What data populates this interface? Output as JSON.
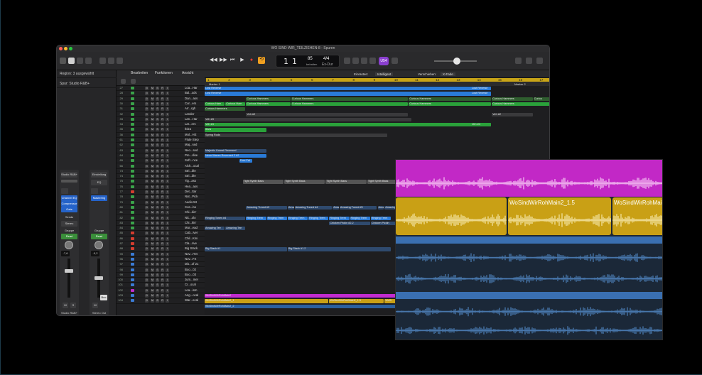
{
  "window": {
    "title": "WO SIND WIR_TEILZIEHEN-8 - Spuren"
  },
  "lcd": {
    "bar": "1",
    "beat": "1",
    "tempo": "85",
    "tempo_label": "behalten",
    "signature": "4/4",
    "key": "Es-Dur"
  },
  "mode_button": "U54",
  "inspector": {
    "region_label": "Region: 3 ausgewählt",
    "track_label": "Spur: Studio R&B+",
    "strip1": {
      "name": "Studio R&B+",
      "settings": "Studio R&B+",
      "eq": "Channel EQ",
      "comp": "Compressor",
      "gate": "Gate",
      "sends": "Sends",
      "stereo": "Stereo",
      "group": "Gruppe",
      "read": "Read",
      "value": "-7,6",
      "m": "M",
      "s": "S"
    },
    "strip2": {
      "name": "Stereo Out",
      "settings": "Einstellung",
      "eq": "EQ",
      "mastering": "Mastering",
      "group": "Gruppe",
      "read": "Read",
      "value": "-0,2",
      "m": "M",
      "bnc": "Bnc"
    }
  },
  "track_header": {
    "menus": [
      "Bearbeiten",
      "Funktionen",
      "Ansicht"
    ]
  },
  "tracks": [
    {
      "num": "27",
      "name": "Loa...Har",
      "color": "#3aa34a"
    },
    {
      "num": "28",
      "name": "Bal...ods",
      "color": "#3aa34a"
    },
    {
      "num": "29",
      "name": "Dan...ass",
      "color": "#3aa34a"
    },
    {
      "num": "30",
      "name": "Cur...ers",
      "color": "#3aa34a"
    },
    {
      "num": "31",
      "name": "Arr...rgh",
      "color": "#3aa34a"
    },
    {
      "num": "32",
      "name": "Lander",
      "color": "#3aa34a"
    },
    {
      "num": "33",
      "name": "Lan...Har",
      "color": "#3aa34a"
    },
    {
      "num": "34",
      "name": "Lar...ers",
      "color": "#3aa34a"
    },
    {
      "num": "35",
      "name": "Ibiza",
      "color": "#3aa34a"
    },
    {
      "num": "36",
      "name": "Mol...HE",
      "color": "#3aa34a"
    },
    {
      "num": "61",
      "name": "Flute Step",
      "color": "#3aa34a"
    },
    {
      "num": "62",
      "name": "Maj...sed",
      "color": "#3aa34a"
    },
    {
      "num": "63",
      "name": "Neo...sed",
      "color": "#3aa34a"
    },
    {
      "num": "64",
      "name": "Pre...dise",
      "color": "#3aa34a"
    },
    {
      "num": "65",
      "name": "Soft...nce",
      "color": "#3aa34a"
    },
    {
      "num": "66",
      "name": "Alch...ocal",
      "color": "#3aa34a"
    },
    {
      "num": "73",
      "name": "Stri...ble",
      "color": "#3aa34a"
    },
    {
      "num": "74",
      "name": "Stri...ble",
      "color": "#3aa34a"
    },
    {
      "num": "75",
      "name": "Tig...ass",
      "color": "#3aa34a"
    },
    {
      "num": "76",
      "name": "Hea...ass",
      "color": "#3aa34a"
    },
    {
      "num": "77",
      "name": "Det...ttar",
      "color": "#d43d2f"
    },
    {
      "num": "78",
      "name": "Nat...Pick",
      "color": "#3aa34a"
    },
    {
      "num": "79",
      "name": "Audio 53",
      "color": "#3aa34a"
    },
    {
      "num": "80",
      "name": "Cos...bo",
      "color": "#3aa34a"
    },
    {
      "num": "81",
      "name": "Chi...kin'",
      "color": "#3aa34a"
    },
    {
      "num": "82",
      "name": "Nic...olo",
      "color": "#3aa34a"
    },
    {
      "num": "83",
      "name": "Chi...kin'",
      "color": "#3aa34a"
    },
    {
      "num": "84",
      "name": "Mur...ead",
      "color": "#3aa34a"
    },
    {
      "num": "85",
      "name": "Cab...iver",
      "color": "#d43d2f"
    },
    {
      "num": "86",
      "name": "Chil...Kini",
      "color": "#d43d2f"
    },
    {
      "num": "87",
      "name": "Cla...rive",
      "color": "#d43d2f"
    },
    {
      "num": "88",
      "name": "Big Stack",
      "color": "#d43d2f"
    },
    {
      "num": "99",
      "name": "Nov...r'94",
      "color": "#3a7bd5"
    },
    {
      "num": "96",
      "name": "Nov...FX",
      "color": "#3a7bd5"
    },
    {
      "num": "97",
      "name": "Dis...of 21",
      "color": "#3a7bd5"
    },
    {
      "num": "98",
      "name": "Boo...02",
      "color": "#3a7bd5"
    },
    {
      "num": "99",
      "name": "Boo...03",
      "color": "#3a7bd5"
    },
    {
      "num": "100",
      "name": "Jum...mer",
      "color": "#3a7bd5"
    },
    {
      "num": "101",
      "name": "Cr...ocal",
      "color": "#3a7bd5"
    },
    {
      "num": "102",
      "name": "Lea...ism",
      "color": "#c22bd0"
    },
    {
      "num": "103",
      "name": "Ang...ocal",
      "color": "#3a7bd5"
    },
    {
      "num": "104",
      "name": "War...ocal",
      "color": "#3a7bd5"
    }
  ],
  "arrange": {
    "toolbar": {
      "snap_label": "Einrasten:",
      "snap_value": "Intelligent",
      "drag_label": "Verschieben:",
      "drag_value": "X-Fade"
    },
    "bars": [
      "1",
      "2",
      "3",
      "4",
      "5",
      "6",
      "7",
      "8",
      "9",
      "10",
      "11",
      "12",
      "13",
      "14",
      "15",
      "16",
      "17"
    ],
    "markers": [
      "Marker 1",
      "Marker 2"
    ],
    "regions": [
      {
        "lane": 0,
        "start": 0.0,
        "end": 0.83,
        "color": "#2a7bd8",
        "label": "Lost Reverse"
      },
      {
        "lane": 0,
        "start": 0.77,
        "end": 0.83,
        "color": "#2a7bd8",
        "label": "Lost Reverse"
      },
      {
        "lane": 1,
        "start": 0.0,
        "end": 0.83,
        "color": "#2a7bd8",
        "label": "Lost Reverse"
      },
      {
        "lane": 1,
        "start": 0.77,
        "end": 0.83,
        "color": "#2a7bd8",
        "label": "Lost Reverse"
      },
      {
        "lane": 2,
        "start": 0.12,
        "end": 0.25,
        "color": "#2f5e2f",
        "label": "Curious Hammers"
      },
      {
        "lane": 2,
        "start": 0.25,
        "end": 0.59,
        "color": "#2f5e2f",
        "label": "Curious Hammers"
      },
      {
        "lane": 2,
        "start": 0.59,
        "end": 0.83,
        "color": "#2f5e2f",
        "label": "Curious Hammers"
      },
      {
        "lane": 2,
        "start": 0.83,
        "end": 0.95,
        "color": "#2f5e2f",
        "label": "Curious Hammers"
      },
      {
        "lane": 2,
        "start": 0.95,
        "end": 1.0,
        "color": "#2f5e2f",
        "label": "Curiou"
      },
      {
        "lane": 3,
        "start": 0.0,
        "end": 0.06,
        "color": "#2aa13a",
        "label": "Curious Ham"
      },
      {
        "lane": 3,
        "start": 0.06,
        "end": 0.12,
        "color": "#2aa13a",
        "label": "Curious Ham"
      },
      {
        "lane": 3,
        "start": 0.12,
        "end": 0.25,
        "color": "#2aa13a",
        "label": "Curious Hammers"
      },
      {
        "lane": 3,
        "start": 0.25,
        "end": 0.59,
        "color": "#2aa13a",
        "label": "Curious Hammers"
      },
      {
        "lane": 3,
        "start": 0.59,
        "end": 0.83,
        "color": "#2aa13a",
        "label": "Curious Hammers"
      },
      {
        "lane": 3,
        "start": 0.83,
        "end": 1.0,
        "color": "#2aa13a",
        "label": "Curious Hammers"
      },
      {
        "lane": 4,
        "start": 0.0,
        "end": 0.12,
        "color": "#2f5e2f",
        "label": "Curious Hammers"
      },
      {
        "lane": 5,
        "start": 0.12,
        "end": 0.59,
        "color": "#3a3a3c",
        "label": "Veh #2"
      },
      {
        "lane": 5,
        "start": 0.83,
        "end": 0.95,
        "color": "#3a3a3c",
        "label": "Veh #2"
      },
      {
        "lane": 6,
        "start": 0.0,
        "end": 0.6,
        "color": "#3a3a3c",
        "label": "Veh #3"
      },
      {
        "lane": 7,
        "start": 0.0,
        "end": 0.83,
        "color": "#2aa13a",
        "label": "Veh #4"
      },
      {
        "lane": 7,
        "start": 0.77,
        "end": 0.83,
        "color": "#2aa13a",
        "label": "Veh #4"
      },
      {
        "lane": 8,
        "start": 0.0,
        "end": 0.18,
        "color": "#2aa13a",
        "label": "Ibiza"
      },
      {
        "lane": 9,
        "start": 0.0,
        "end": 0.53,
        "color": "#3a3a3c",
        "label": "Spring Rods"
      },
      {
        "lane": 12,
        "start": 0.0,
        "end": 0.18,
        "color": "#2f4a6e",
        "label": "Majestic Unreal Reversed"
      },
      {
        "lane": 13,
        "start": 0.0,
        "end": 0.18,
        "color": "#2a7bd8",
        "label": "Neon Waves Reversed 2 #2"
      },
      {
        "lane": 14,
        "start": 0.1,
        "end": 0.14,
        "color": "#2a7bd8",
        "label": "Free Fal"
      },
      {
        "lane": 14,
        "start": 0.58,
        "end": 0.62,
        "color": "#2a7bd8",
        "label": "Free Fal"
      },
      {
        "lane": 18,
        "start": 0.11,
        "end": 0.23,
        "color": "#555",
        "label": "Tight Synth Bass"
      },
      {
        "lane": 18,
        "start": 0.23,
        "end": 0.35,
        "color": "#555",
        "label": "Tight Synth Bass"
      },
      {
        "lane": 18,
        "start": 0.35,
        "end": 0.47,
        "color": "#555",
        "label": "Tight Synth Bass"
      },
      {
        "lane": 18,
        "start": 0.47,
        "end": 0.6,
        "color": "#555",
        "label": "Tight Synth Bass"
      },
      {
        "lane": 23,
        "start": 0.12,
        "end": 0.24,
        "color": "#2f4a6e",
        "label": "Amazing Tuned #3"
      },
      {
        "lane": 23,
        "start": 0.24,
        "end": 0.26,
        "color": "#2f4a6e",
        "label": "Amaz"
      },
      {
        "lane": 23,
        "start": 0.26,
        "end": 0.37,
        "color": "#2f4a6e",
        "label": "Amazing Tuned #4"
      },
      {
        "lane": 23,
        "start": 0.37,
        "end": 0.39,
        "color": "#2f4a6e",
        "label": "Amaz"
      },
      {
        "lane": 23,
        "start": 0.39,
        "end": 0.5,
        "color": "#2f4a6e",
        "label": "Amazing Tuned #5"
      },
      {
        "lane": 23,
        "start": 0.5,
        "end": 0.52,
        "color": "#2f4a6e",
        "label": "Amaz"
      },
      {
        "lane": 23,
        "start": 0.52,
        "end": 0.6,
        "color": "#2f4a6e",
        "label": "Amazing Tuned"
      },
      {
        "lane": 25,
        "start": 0.0,
        "end": 0.12,
        "color": "#2f4a6e",
        "label": "Ringing Tones #4"
      },
      {
        "lane": 25,
        "start": 0.12,
        "end": 0.18,
        "color": "#2a7bd8",
        "label": "Ringing Trem"
      },
      {
        "lane": 25,
        "start": 0.18,
        "end": 0.24,
        "color": "#2a7bd8",
        "label": "Ringing Trem"
      },
      {
        "lane": 25,
        "start": 0.24,
        "end": 0.3,
        "color": "#2a7bd8",
        "label": "Ringing Trem"
      },
      {
        "lane": 25,
        "start": 0.3,
        "end": 0.36,
        "color": "#2a7bd8",
        "label": "Ringing Trem"
      },
      {
        "lane": 25,
        "start": 0.36,
        "end": 0.42,
        "color": "#2a7bd8",
        "label": "Ringing Trem"
      },
      {
        "lane": 25,
        "start": 0.42,
        "end": 0.48,
        "color": "#2a7bd8",
        "label": "Ringing Trem"
      },
      {
        "lane": 25,
        "start": 0.48,
        "end": 0.54,
        "color": "#2a7bd8",
        "label": "Ringing Trem"
      },
      {
        "lane": 26,
        "start": 0.36,
        "end": 0.48,
        "color": "#2f4a6e",
        "label": "Chicken Pickin #2.2"
      },
      {
        "lane": 26,
        "start": 0.48,
        "end": 0.6,
        "color": "#2f4a6e",
        "label": "Chicken Pickin"
      },
      {
        "lane": 27,
        "start": 0.0,
        "end": 0.06,
        "color": "#2f4a6e",
        "label": "Amazing Tee"
      },
      {
        "lane": 27,
        "start": 0.06,
        "end": 0.12,
        "color": "#2f4a6e",
        "label": "Amazing Tee"
      },
      {
        "lane": 31,
        "start": 0.0,
        "end": 0.24,
        "color": "#2f4a6e",
        "label": "Big Stack #1"
      },
      {
        "lane": 31,
        "start": 0.24,
        "end": 0.54,
        "color": "#2f4a6e",
        "label": "Big Stack #1.2"
      },
      {
        "lane": 40,
        "start": 0.0,
        "end": 0.6,
        "color": "#c22bd0",
        "label": "WoSindWirRohMain2"
      },
      {
        "lane": 41,
        "start": 0.0,
        "end": 0.36,
        "color": "#c9a015",
        "label": "WoSindWirRohMain2_1"
      },
      {
        "lane": 41,
        "start": 0.36,
        "end": 0.52,
        "color": "#c9a015",
        "label": "WoSindWirRohMain2_1.5"
      },
      {
        "lane": 41,
        "start": 0.52,
        "end": 0.6,
        "color": "#c9a015",
        "label": "WoSi"
      },
      {
        "lane": 42,
        "start": 0.0,
        "end": 0.6,
        "color": "#2a5f9e",
        "label": "WoSindWirRohMain2_2"
      }
    ]
  },
  "zoom": {
    "region1_label": "WoSindWirRohMain2_1.5",
    "region2_label": "WoSindWirRohMai"
  }
}
